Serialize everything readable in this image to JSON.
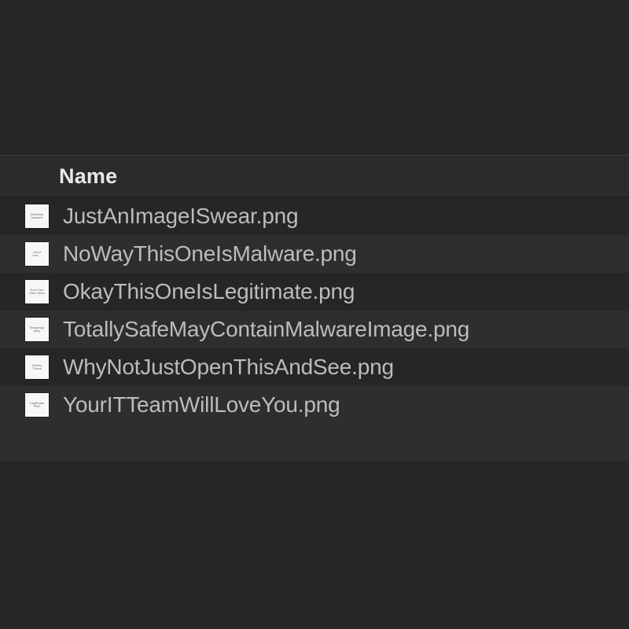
{
  "header": {
    "column_name": "Name"
  },
  "files": [
    {
      "name": "JustAnImageISwear.png",
      "thumb_text": "Definitely Malware"
    },
    {
      "name": "NoWayThisOneIsMalware.png",
      "thumb_text": "Good luck…"
    },
    {
      "name": "OkayThisOneIsLegitimate.png",
      "thumb_text": "Don't You Dare Open"
    },
    {
      "name": "TotallySafeMayContainMalwareImage.png",
      "thumb_text": "Steganography"
    },
    {
      "name": "WhyNotJustOpenThisAndSee.png",
      "thumb_text": "Hidden Threat"
    },
    {
      "name": "YourITTeamWillLoveYou.png",
      "thumb_text": "Legitimate PNG"
    }
  ]
}
